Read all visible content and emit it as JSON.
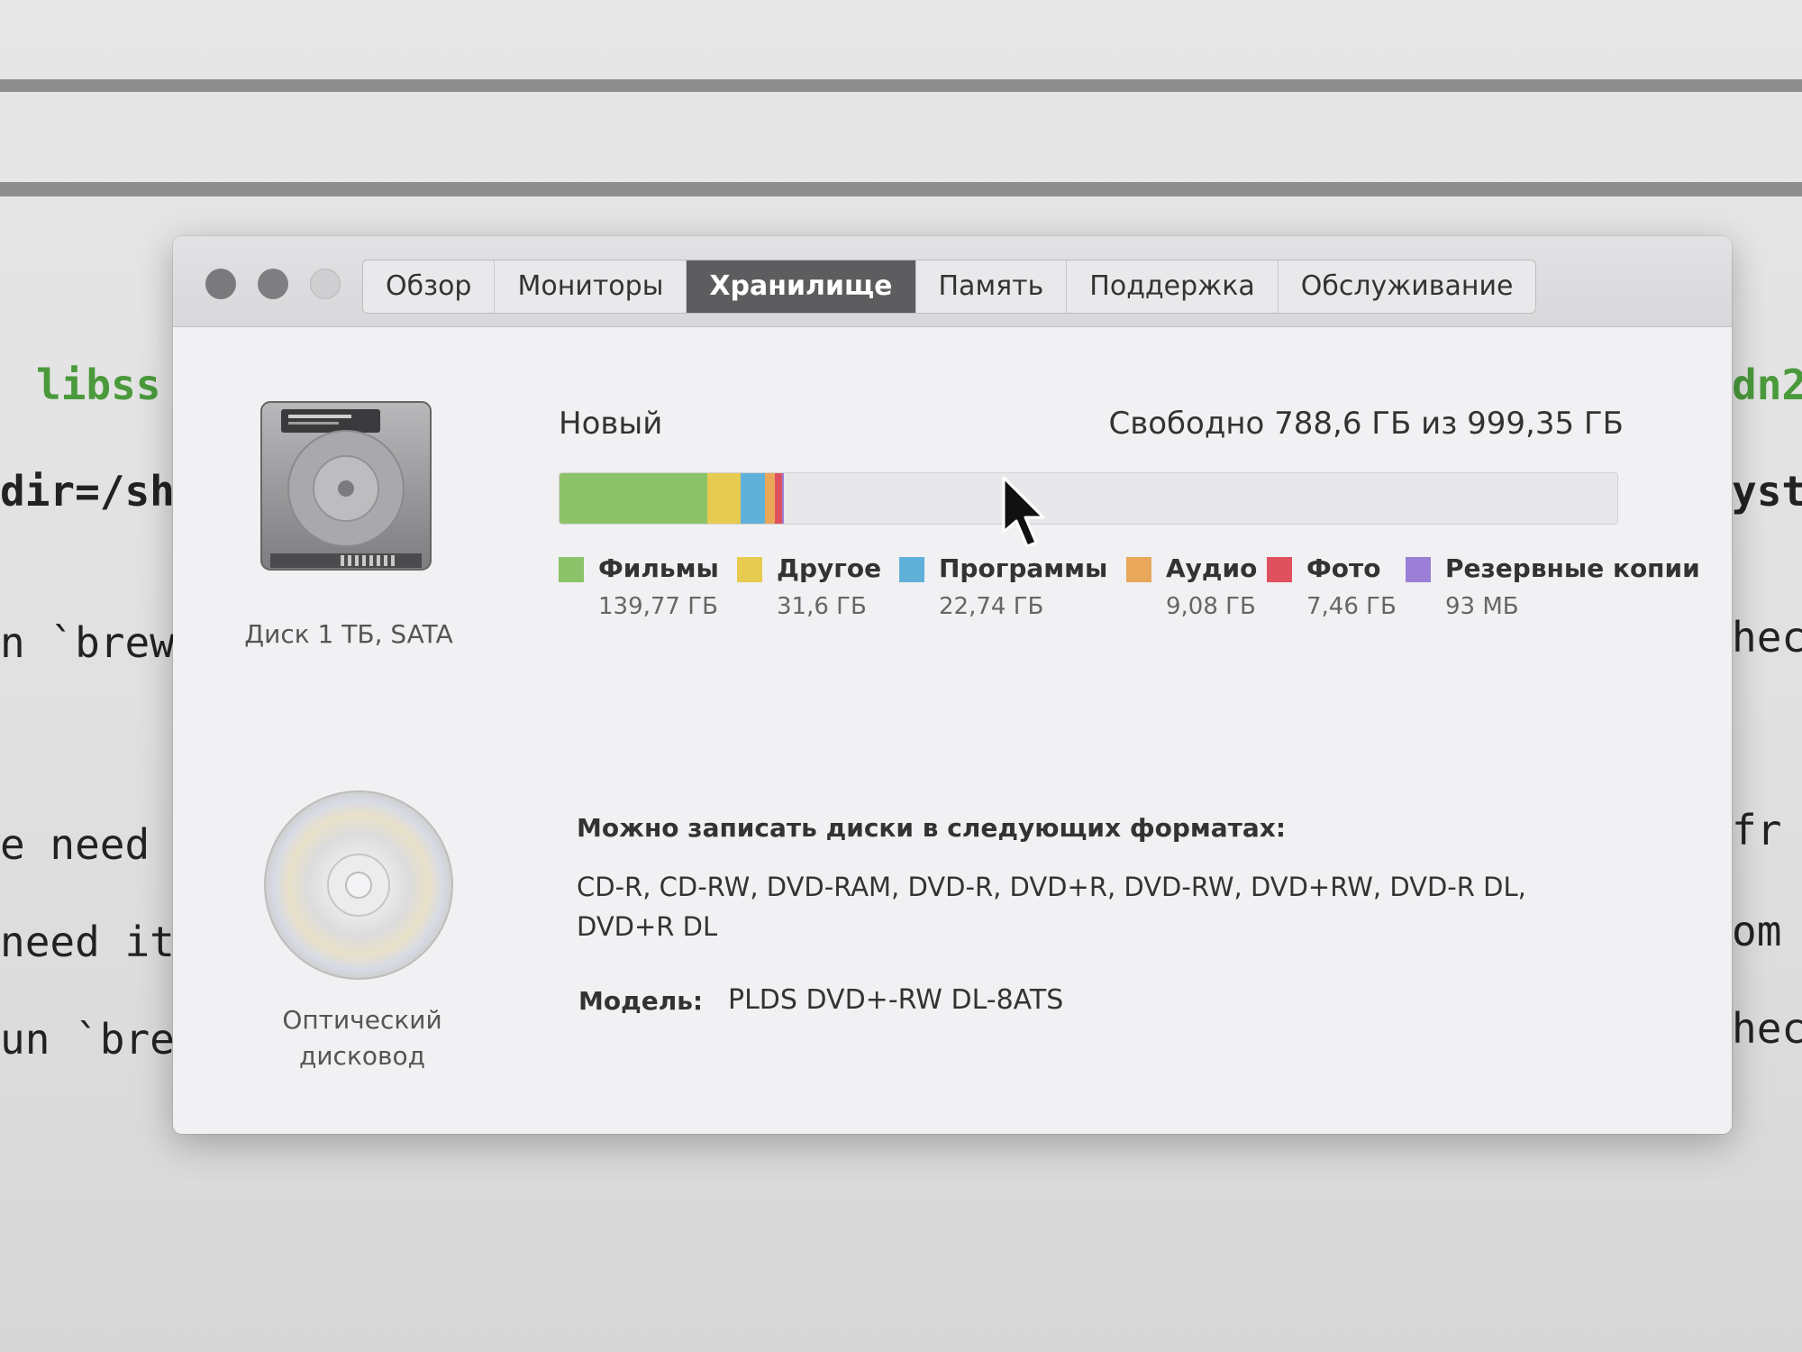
{
  "terminal": {
    "lines_left": [
      "libss",
      "dir=/sh",
      "n `brew",
      "e need",
      "need it",
      "un `brew"
    ],
    "lines_right": [
      "dn2",
      "yst",
      "hec",
      "fr",
      "om",
      "heck"
    ]
  },
  "window": {
    "tabs": [
      {
        "label": "Обзор",
        "active": false
      },
      {
        "label": "Мониторы",
        "active": false
      },
      {
        "label": "Хранилище",
        "active": true
      },
      {
        "label": "Память",
        "active": false
      },
      {
        "label": "Поддержка",
        "active": false
      },
      {
        "label": "Обслуживание",
        "active": false
      }
    ]
  },
  "storage": {
    "disk_label": "Диск 1 ТБ, SATA",
    "volume_name": "Новый",
    "free_space": "Свободно 788,6 ГБ из 999,35 ГБ",
    "total_gb": 999.35,
    "categories": [
      {
        "name": "Фильмы",
        "size": "139,77 ГБ",
        "gb": 139.77,
        "color": "#8cc36a"
      },
      {
        "name": "Другое",
        "size": "31,6 ГБ",
        "gb": 31.6,
        "color": "#e6cb50"
      },
      {
        "name": "Программы",
        "size": "22,74 ГБ",
        "gb": 22.74,
        "color": "#5fb1d9"
      },
      {
        "name": "Аудио",
        "size": "9,08 ГБ",
        "gb": 9.08,
        "color": "#e9a75a"
      },
      {
        "name": "Фото",
        "size": "7,46 ГБ",
        "gb": 7.46,
        "color": "#e0515f"
      },
      {
        "name": "Резервные копии",
        "size": "93 МБ",
        "gb": 0.093,
        "color": "#9b7fd6"
      }
    ]
  },
  "optical": {
    "label": "Оптический дисковод",
    "burn_title": "Можно записать диски в следующих форматах:",
    "formats": "CD-R, CD-RW, DVD-RAM, DVD-R, DVD+R, DVD-RW, DVD+RW, DVD-R DL, DVD+R DL",
    "model_label": "Модель:",
    "model_value": "PLDS DVD+-RW DL-8ATS"
  }
}
